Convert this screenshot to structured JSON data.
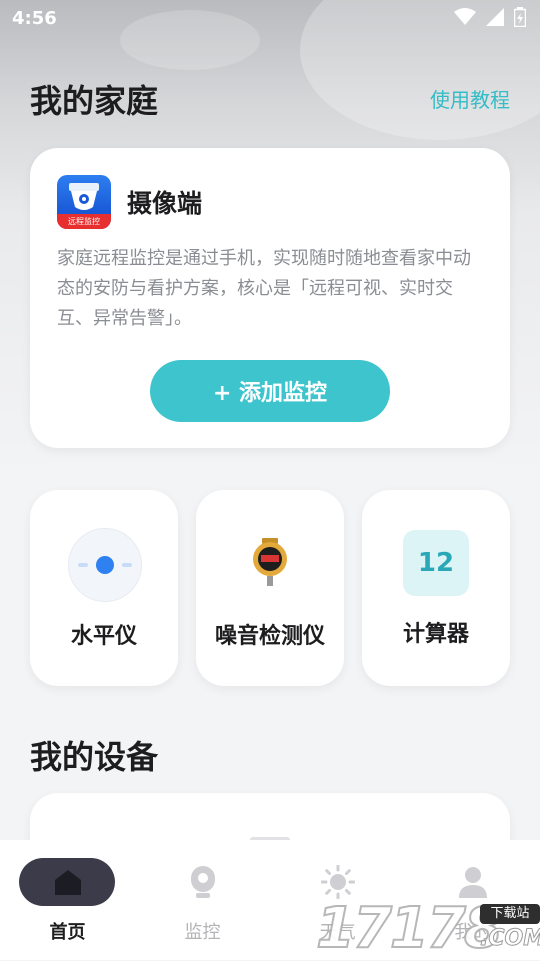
{
  "status_bar": {
    "time": "4:56"
  },
  "header": {
    "title": "我的家庭",
    "tutorial_link": "使用教程"
  },
  "camera_card": {
    "title": "摄像端",
    "logo_text": "远程监控",
    "description": "家庭远程监控是通过手机，实现随时随地查看家中动态的安防与看护方案，核心是「远程可视、实时交互、异常告警」。",
    "add_button": "+ 添加监控"
  },
  "tools": [
    {
      "label": "水平仪",
      "icon": "level-icon"
    },
    {
      "label": "噪音检测仪",
      "icon": "noise-meter-icon"
    },
    {
      "label": "计算器",
      "icon": "calculator-icon",
      "icon_text": "12"
    }
  ],
  "devices_section": {
    "title": "我的设备"
  },
  "tab_bar": {
    "tabs": [
      {
        "label": "首页",
        "icon": "home-icon",
        "active": true
      },
      {
        "label": "监控",
        "icon": "camera-icon",
        "active": false
      },
      {
        "label": "天气",
        "icon": "sun-icon",
        "active": false
      },
      {
        "label": "我的",
        "icon": "user-icon",
        "active": false
      }
    ]
  },
  "watermark": {
    "digits": "17178",
    "badge": "下载站",
    "suffix": ".COM"
  },
  "colors": {
    "accent": "#3ec4cc",
    "link": "#32bdc7",
    "active_tab_pill": "#3b3b49",
    "level_dot": "#2f80f1"
  }
}
